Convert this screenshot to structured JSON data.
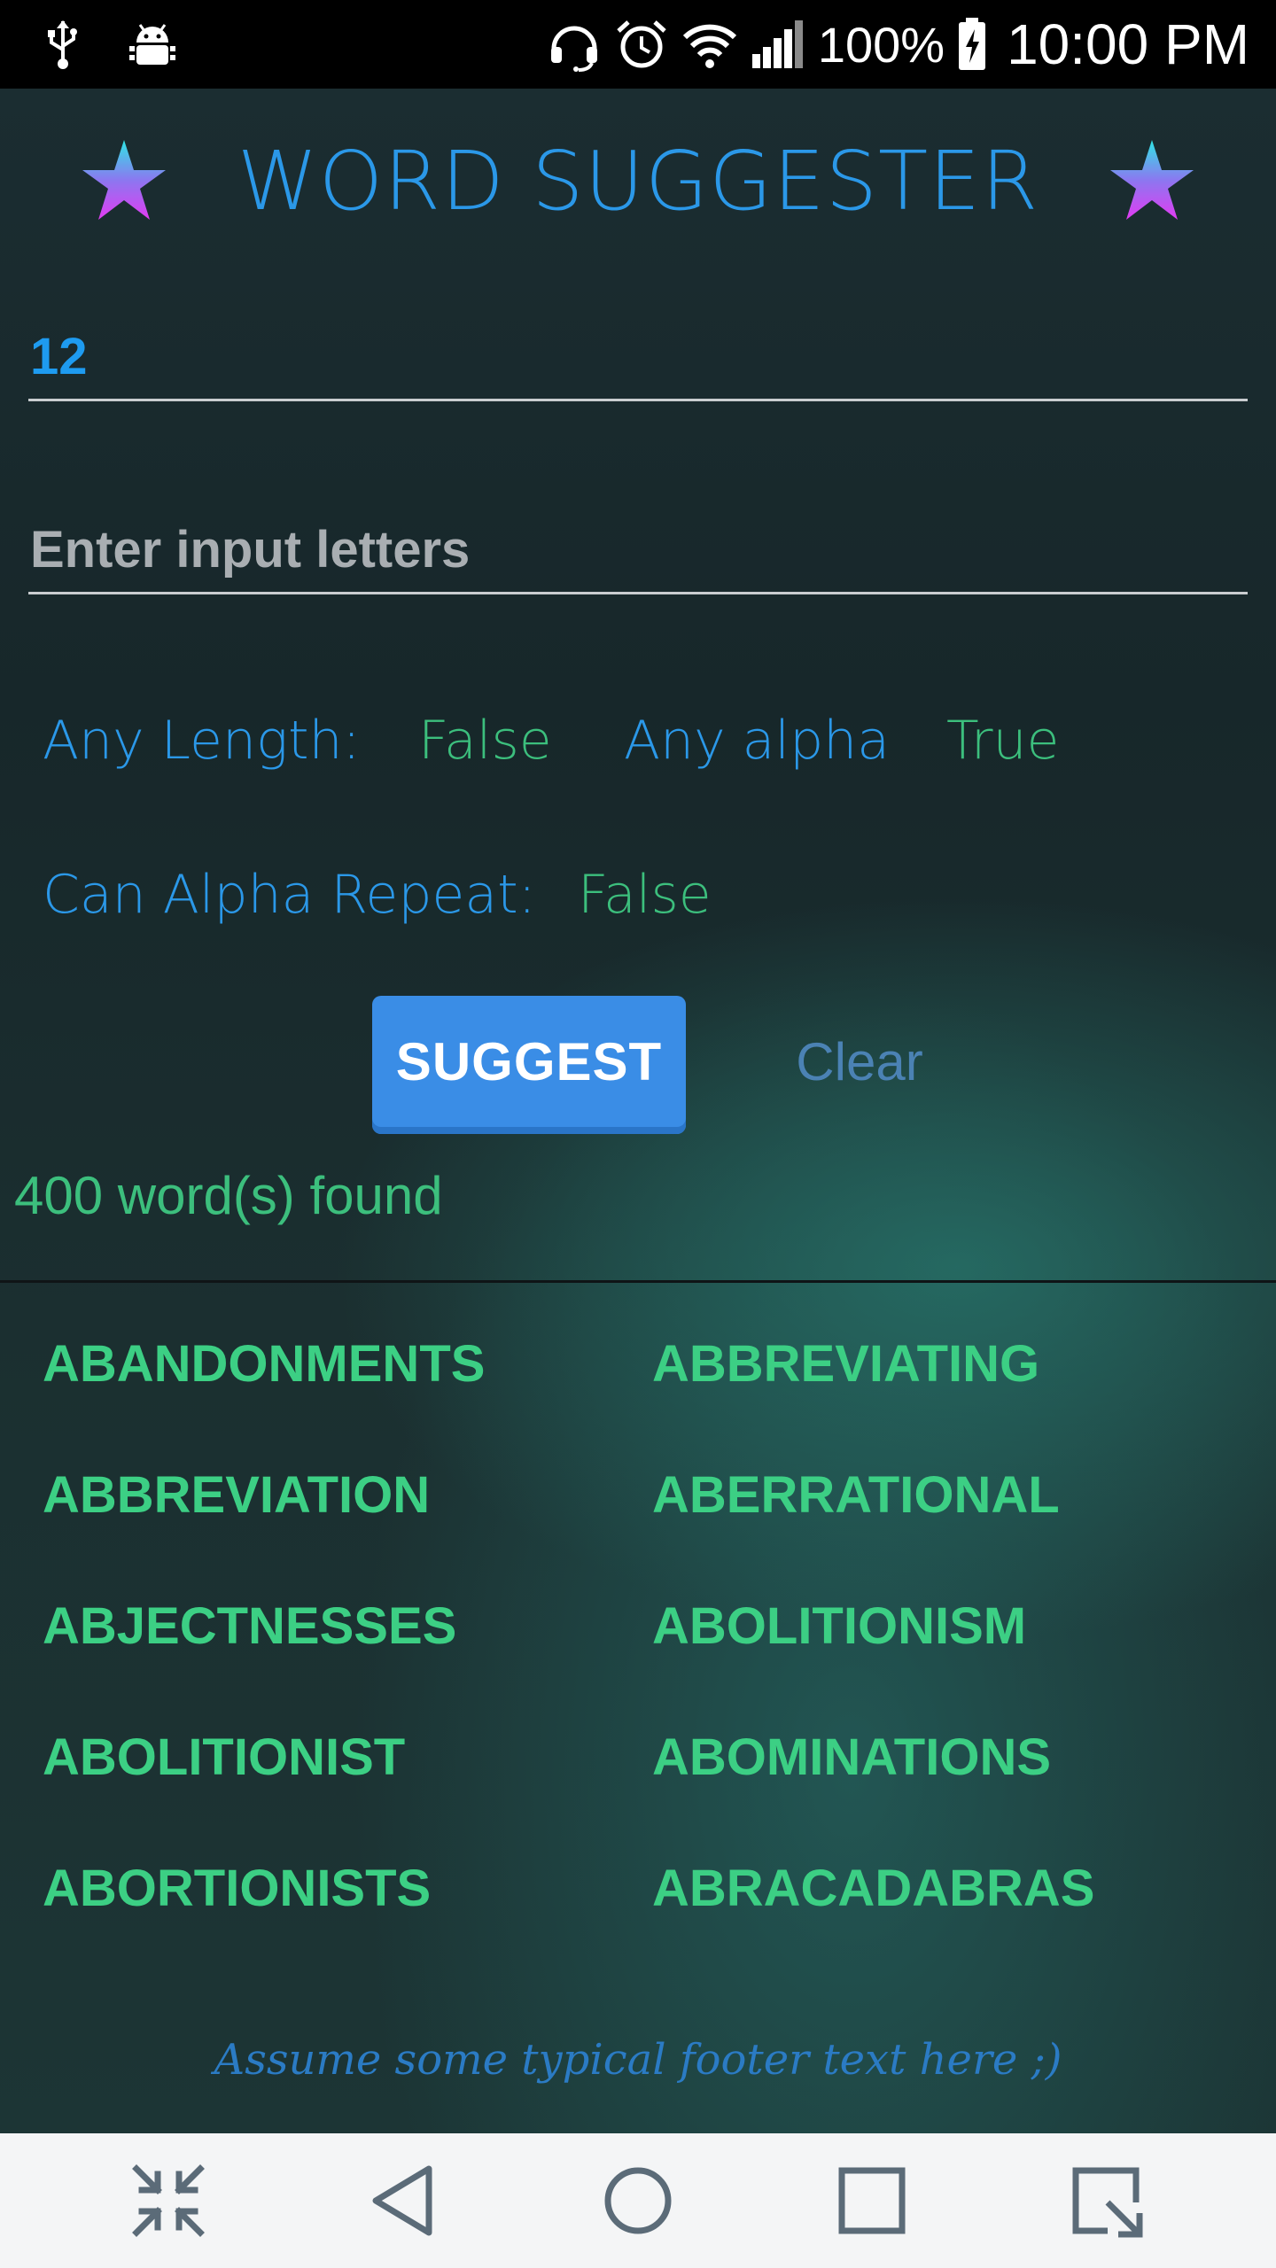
{
  "status_bar": {
    "icons": [
      "usb-icon",
      "android-debug-icon",
      "headset-icon",
      "alarm-icon",
      "wifi-icon",
      "signal-icon",
      "battery-charging-icon"
    ],
    "battery": "100%",
    "time": "10:00 PM"
  },
  "header": {
    "title": "WORD SUGGESTER",
    "left_icon": "star-icon",
    "right_icon": "star-icon"
  },
  "inputs": {
    "length_value": "12",
    "letters_value": "",
    "letters_placeholder": "Enter input letters"
  },
  "options": {
    "any_length_label": "Any Length:",
    "any_length_value": "False",
    "any_alpha_label": "Any alpha",
    "any_alpha_value": "True",
    "alpha_repeat_label": "Can Alpha Repeat:",
    "alpha_repeat_value": "False"
  },
  "actions": {
    "suggest_label": "SUGGEST",
    "clear_label": "Clear"
  },
  "results": {
    "count_text": "400 word(s) found",
    "words": [
      "ABANDONMENTS",
      "ABBREVIATING",
      "ABBREVIATION",
      "ABERRATIONAL",
      "ABJECTNESSES",
      "ABOLITIONISM",
      "ABOLITIONIST",
      "ABOMINATIONS",
      "ABORTIONISTS",
      "ABRACADABRAS"
    ]
  },
  "footer": {
    "text": "Assume some typical footer text here ;)"
  },
  "nav_bar": {
    "icons": [
      "collapse-icon",
      "back-icon",
      "home-icon",
      "recents-icon",
      "screenshot-capture-icon"
    ]
  },
  "colors": {
    "title_blue": "#2b98e8",
    "value_green": "#3cbf7d",
    "word_green": "#3ccf84",
    "button_blue": "#3a8de6",
    "clear_blue": "#4b82b4"
  }
}
